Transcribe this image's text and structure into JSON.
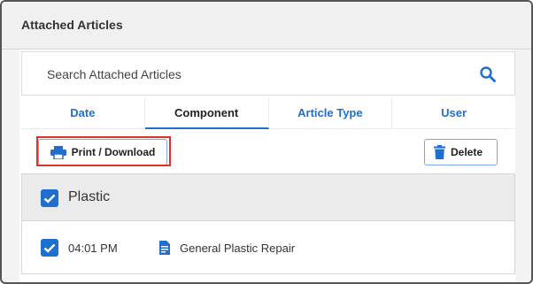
{
  "header": {
    "title": "Attached Articles"
  },
  "search": {
    "placeholder": "Search Attached Articles",
    "value": ""
  },
  "tabs": [
    {
      "label": "Date",
      "active": false
    },
    {
      "label": "Component",
      "active": true
    },
    {
      "label": "Article Type",
      "active": false
    },
    {
      "label": "User",
      "active": false
    }
  ],
  "toolbar": {
    "print_label": "Print / Download",
    "delete_label": "Delete"
  },
  "groups": [
    {
      "label": "Plastic",
      "checked": true,
      "items": [
        {
          "time": "04:01 PM",
          "icon": "document-icon",
          "title": "General Plastic Repair",
          "checked": true
        }
      ]
    }
  ],
  "colors": {
    "accent": "#1f6fd1",
    "highlight": "#d9342b",
    "header_bg": "#f0f0f0"
  }
}
